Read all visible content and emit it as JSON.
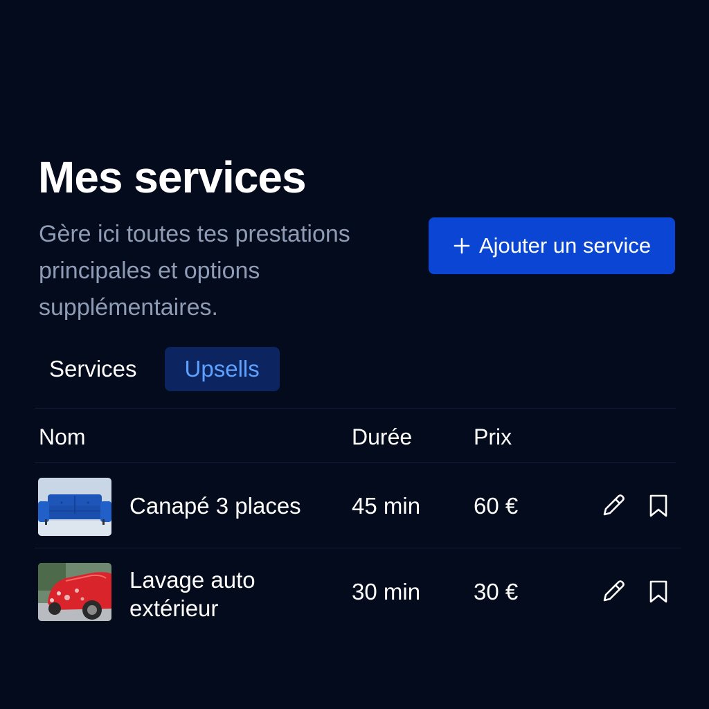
{
  "header": {
    "title": "Mes services",
    "subtitle": "Gère ici toutes tes prestations principales et options supplémentaires.",
    "add_button_label": "Ajouter un service"
  },
  "tabs": [
    {
      "label": "Services",
      "active": false
    },
    {
      "label": "Upsells",
      "active": true
    }
  ],
  "table": {
    "columns": [
      "Nom",
      "Durée",
      "Prix"
    ],
    "rows": [
      {
        "thumbnail": "blue-sofa-image",
        "name": "Canapé 3 places",
        "duration": "45 min",
        "price": "60 €",
        "actions": [
          "pencil-icon",
          "bookmark-icon"
        ]
      },
      {
        "thumbnail": "red-car-wash-image",
        "name": "Lavage auto extérieur",
        "duration": "30 min",
        "price": "30 €",
        "actions": [
          "pencil-icon",
          "bookmark-icon"
        ]
      }
    ]
  },
  "colors": {
    "background": "#040b1c",
    "primary_button": "#0a46d3",
    "active_tab_bg": "#0c2560",
    "active_tab_text": "#5fa1ff",
    "muted_text": "#8f9cb6"
  }
}
